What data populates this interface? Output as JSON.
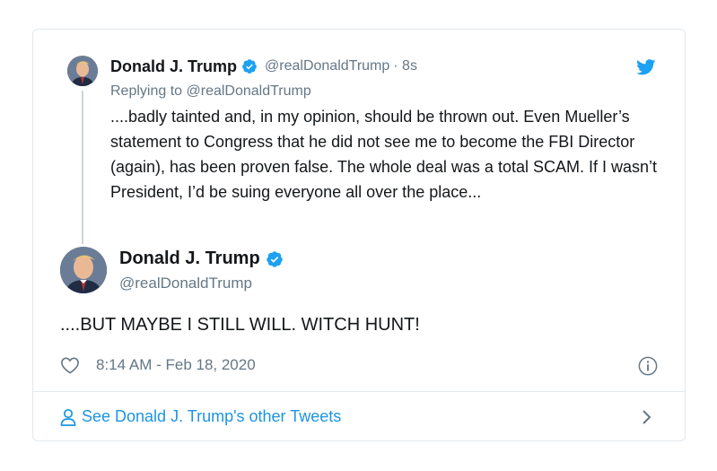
{
  "reply_tweet": {
    "author_name": "Donald J. Trump",
    "handle": "@realDonaldTrump",
    "time": "· 8s",
    "replying_to": "Replying to @realDonaldTrump",
    "text": "....badly tainted and, in my opinion, should be thrown out. Even Mueller’s statement to Congress that he did not see me to become the FBI Director (again), has been proven false. The whole deal was a total SCAM. If I wasn’t President, I’d be suing everyone all over the place..."
  },
  "main_tweet": {
    "author_name": "Donald J. Trump",
    "handle": "@realDonaldTrump",
    "text": "....BUT MAYBE I STILL WILL. WITCH HUNT!",
    "timestamp": "8:14 AM - Feb 18, 2020"
  },
  "footer": {
    "link_label": "See Donald J. Trump's other Tweets"
  },
  "colors": {
    "accent": "#1da1f2",
    "link": "#1b95e0",
    "secondary_text": "#657786",
    "border": "#e1e8ed"
  },
  "icons": [
    "twitter-bird-icon",
    "verified-badge-icon",
    "heart-icon",
    "info-icon",
    "person-icon",
    "chevron-right-icon"
  ]
}
